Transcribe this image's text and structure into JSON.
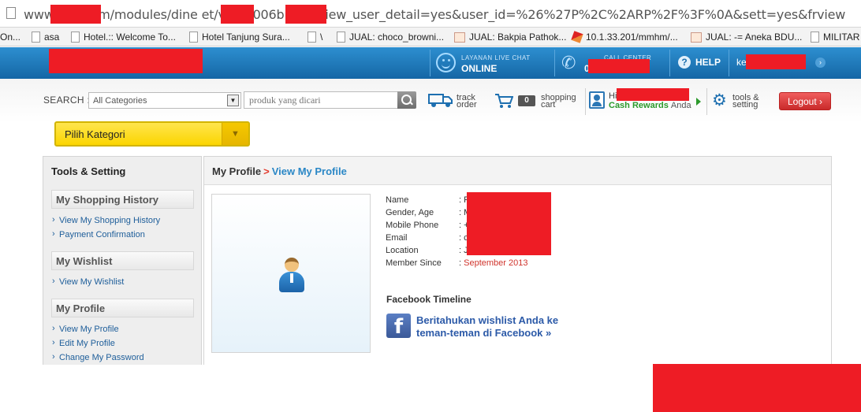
{
  "browser": {
    "url": "www.       ket.com/modules/dine       et/vdi        et006b.cfm?view_user_detail=yes&user_id=%26%27P%2C%2ARP%2F%3F%0A&sett=yes&frview",
    "bookmarks": [
      {
        "label": "On..."
      },
      {
        "label": "asa"
      },
      {
        "label": "Hotel.:: Welcome To..."
      },
      {
        "label": "Hotel Tanjung Sura..."
      },
      {
        "label": "\\"
      },
      {
        "label": "JUAL: choco_browni..."
      },
      {
        "label": "JUAL: Bakpia Pathok..."
      },
      {
        "label": "10.1.33.201/mmhm/..."
      },
      {
        "label": "JUAL: -= Aneka BDU..."
      },
      {
        "label": "MILITAR"
      }
    ]
  },
  "header": {
    "live_chat_label": "LAYANAN LIVE CHAT",
    "live_chat_status": "ONLINE",
    "call_center_label": "CALL CENTER",
    "call_center_number": "0               66",
    "help_label": "HELP",
    "user_prefix": "ke"
  },
  "toolbar": {
    "search_label": "SEARCH :",
    "category_select": "All Categories",
    "search_placeholder": "produk yang dicari",
    "track_line1": "track",
    "track_line2": "order",
    "cart_count": "0",
    "cart_line1": "shopping",
    "cart_line2": "cart",
    "hi_prefix": "Hi",
    "cash_rewards": "Cash Rewards",
    "cash_suffix": "Anda",
    "tools_line1": "tools &",
    "tools_line2": "setting",
    "logout_label": "Logout ›",
    "kategori_label": "Pilih Kategori"
  },
  "sidebar": {
    "title": "Tools & Setting",
    "sections": [
      {
        "title": "My Shopping History",
        "links": [
          "View My Shopping History",
          "Payment Confirmation"
        ]
      },
      {
        "title": "My Wishlist",
        "links": [
          "View My Wishlist"
        ]
      },
      {
        "title": "My Profile",
        "links": [
          "View My Profile",
          "Edit My Profile",
          "Change My Password"
        ]
      }
    ]
  },
  "main": {
    "crumb_root": "My Profile",
    "crumb_sep": ">",
    "crumb_current": "View My Profile",
    "profile_labels": [
      "Name",
      "Gender, Age",
      "Mobile Phone",
      "Email",
      "Location",
      "Member Since"
    ],
    "profile_values": [
      ": P",
      ": M",
      ": +",
      ": c",
      ": J",
      ":"
    ],
    "member_since": "September 2013",
    "facebook_title": "Facebook Timeline",
    "facebook_link": "Beritahukan wishlist Anda ke teman-teman di Facebook »"
  },
  "colors": {
    "header_blue": "#1b76b8",
    "logout_red": "#d83a3a",
    "cash_green": "#2c9a2c",
    "kategori_yellow": "#fbd500",
    "link_blue": "#1e5e9a",
    "redaction_red": "#ee1c25"
  }
}
